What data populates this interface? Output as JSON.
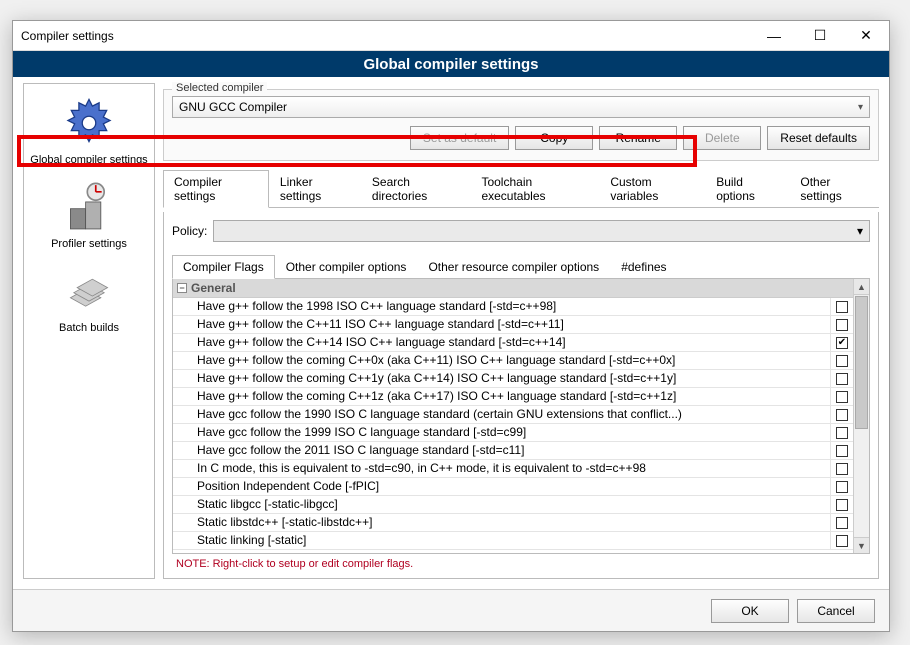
{
  "window": {
    "title": "Compiler settings",
    "banner": "Global compiler settings",
    "minimize": "—",
    "maximize": "☐",
    "close": "✕"
  },
  "sidebar": {
    "items": [
      {
        "label": "Global compiler settings"
      },
      {
        "label": "Profiler settings"
      },
      {
        "label": "Batch builds"
      }
    ]
  },
  "selected_compiler": {
    "label": "Selected compiler",
    "value": "GNU GCC Compiler"
  },
  "compiler_buttons": {
    "set_default": "Set as default",
    "copy": "Copy",
    "rename": "Rename",
    "delete": "Delete",
    "reset": "Reset defaults"
  },
  "main_tabs": [
    "Compiler settings",
    "Linker settings",
    "Search directories",
    "Toolchain executables",
    "Custom variables",
    "Build options",
    "Other settings"
  ],
  "policy_label": "Policy:",
  "inner_tabs": [
    "Compiler Flags",
    "Other compiler options",
    "Other resource compiler options",
    "#defines"
  ],
  "flag_category": "General",
  "flags": [
    {
      "label": "Have g++ follow the 1998 ISO C++ language standard  [-std=c++98]",
      "checked": false
    },
    {
      "label": "Have g++ follow the C++11 ISO C++ language standard  [-std=c++11]",
      "checked": false
    },
    {
      "label": "Have g++ follow the C++14 ISO C++ language standard  [-std=c++14]",
      "checked": true
    },
    {
      "label": "Have g++ follow the coming C++0x (aka C++11) ISO C++ language standard  [-std=c++0x]",
      "checked": false
    },
    {
      "label": "Have g++ follow the coming C++1y (aka C++14) ISO C++ language standard  [-std=c++1y]",
      "checked": false
    },
    {
      "label": "Have g++ follow the coming C++1z (aka C++17) ISO C++ language standard  [-std=c++1z]",
      "checked": false
    },
    {
      "label": "Have gcc follow the 1990 ISO C language standard  (certain GNU extensions that conflict...)",
      "checked": false
    },
    {
      "label": "Have gcc follow the 1999 ISO C language standard  [-std=c99]",
      "checked": false
    },
    {
      "label": "Have gcc follow the 2011 ISO C language standard  [-std=c11]",
      "checked": false
    },
    {
      "label": "In C mode, this is equivalent to -std=c90, in C++ mode, it is equivalent to -std=c++98",
      "checked": false
    },
    {
      "label": "Position Independent Code  [-fPIC]",
      "checked": false
    },
    {
      "label": "Static libgcc  [-static-libgcc]",
      "checked": false
    },
    {
      "label": "Static libstdc++  [-static-libstdc++]",
      "checked": false
    },
    {
      "label": "Static linking  [-static]",
      "checked": false
    }
  ],
  "note": "NOTE: Right-click to setup or edit compiler flags.",
  "footer": {
    "ok": "OK",
    "cancel": "Cancel"
  }
}
